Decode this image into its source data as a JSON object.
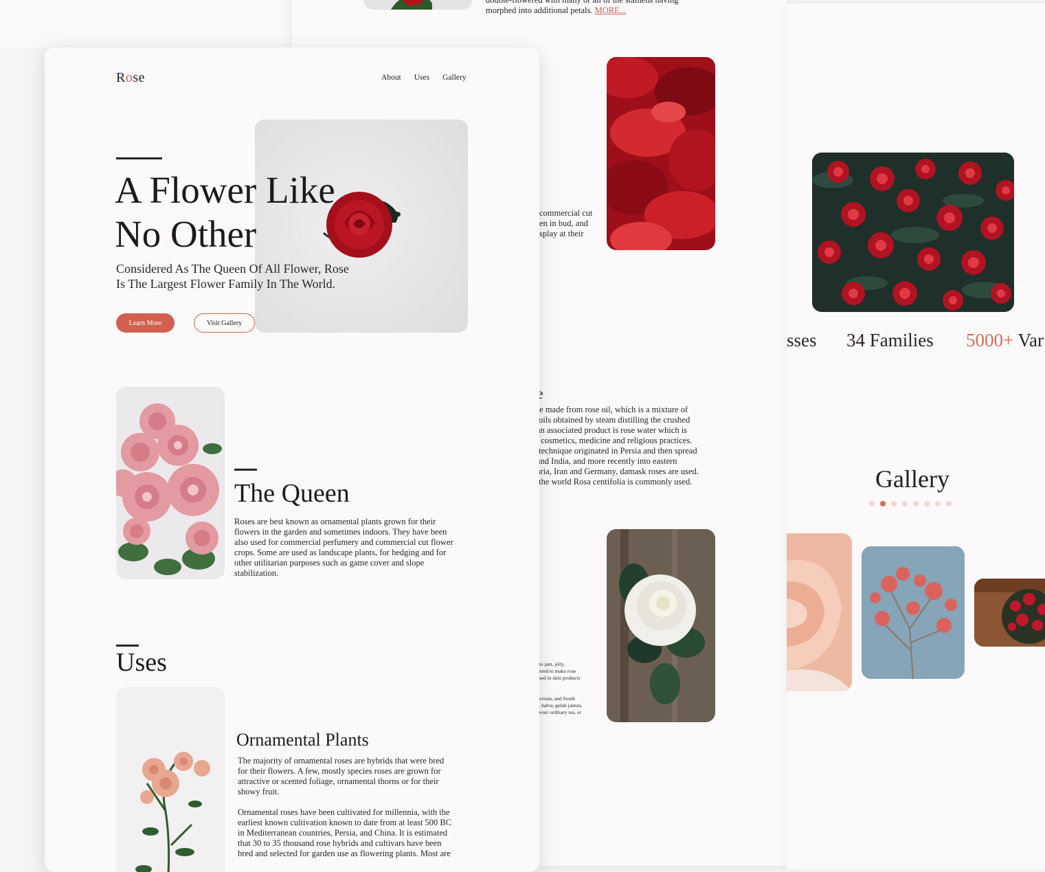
{
  "background_sheets": {
    "middle": {
      "top_snippet": {
        "line1": "double-flowered with many or all of the stamens having",
        "line2": "morphed into additional petals.",
        "more_link": "MORE..."
      },
      "cut_text_lines": [
        "commercial cut",
        "en in bud, and",
        "splay at their"
      ],
      "heading_fragment": "e",
      "paragraph_lines": [
        "re made from rose oil, which is a mixture of",
        " oils obtained by steam distilling the crushed",
        "an associated product is rose water which is",
        ", cosmetics, medicine and religious practices.",
        " technique originated in Persia and then spread",
        "and India, and more recently into eastern",
        "aria, Iran and Germany, damask roses are used.",
        " the world Rosa centifolia is commonly used."
      ],
      "tiny_lines_a": [
        "nto jam, jelly,",
        "ltered to make rose",
        "used in skin products"
      ],
      "tiny_lines_b": [
        "Persian, and South",
        "a, halva, gulab jamun,",
        "avour ordinary tea, or"
      ]
    },
    "right": {
      "stats": {
        "item1_fragment": "sses",
        "families": "34 Families",
        "varieties_accent": "5000+",
        "varieties_fragment": " Var"
      },
      "gallery_title": "Gallery",
      "carousel_dots": 8,
      "active_dot": 2
    }
  },
  "header": {
    "logo_left": "R",
    "logo_accent": "o",
    "logo_right": "se",
    "nav": [
      "About",
      "Uses",
      "Gallery"
    ]
  },
  "hero": {
    "title": "A Flower Like\nNo Other",
    "subtitle": "Considered As The Queen Of All Flower, Rose\nIs The Largest Flower Family In The World.",
    "primary_button": "Learn More",
    "secondary_button": "Visit Gallery"
  },
  "queen": {
    "title": "The Queen",
    "body": "Roses are best known as ornamental plants grown for their\nflowers in the garden and sometimes indoors. They have been\nalso used for commercial perfumery and commercial cut flower\ncrops. Some are used as landscape plants, for hedging and for\nother utilitarian purposes such as game cover and slope\nstabilization."
  },
  "uses": {
    "title": "Uses",
    "subtitle": "Ornamental Plants",
    "paragraph1": "The majority of ornamental roses are hybrids that were bred\nfor their flowers. A few, mostly species roses are grown for\nattractive or scented foliage, ornamental thorns or for their\nshowy fruit.",
    "paragraph2": "Ornamental roses have been cultivated for millennia, with the\nearliest known cultivation known to date from at least 500 BC\nin Mediterranean countries, Persia, and China. It is estimated\nthat 30 to 35 thousand rose hybrids and cultivars have been\nbred and selected for garden use as flowering plants. Most are"
  },
  "colors": {
    "accent": "#d3604f",
    "page": "#fbf9fa",
    "text": "#1f1b1c"
  }
}
